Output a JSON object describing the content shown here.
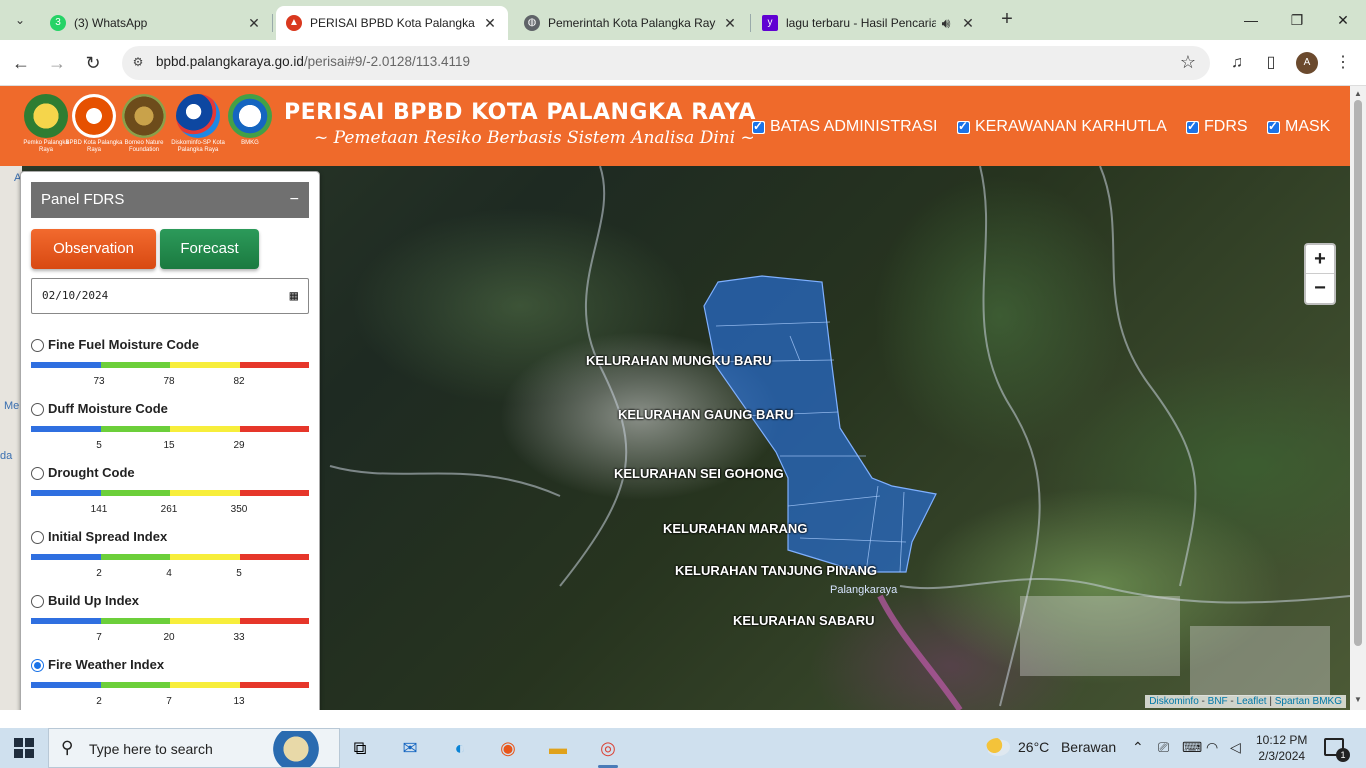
{
  "browser": {
    "tabs": [
      {
        "title": "(3) WhatsApp",
        "icon": "whatsapp-icon",
        "badge": "3",
        "color": "#25d366"
      },
      {
        "title": "PERISAI BPBD Kota Palangka Raya",
        "icon": "bpbd-icon",
        "color": "#d9381e"
      },
      {
        "title": "Pemerintah Kota Palangka Raya",
        "icon": "globe-icon",
        "color": "#5f6368"
      },
      {
        "title": "lagu terbaru - Hasil Pencarian",
        "icon": "yahoo-icon",
        "color": "#6001d2"
      }
    ],
    "url_host": "bpbd.palangkaraya.go.id",
    "url_path": "/perisai#9/-2.0128/113.4119",
    "avatar_initial": "A"
  },
  "header": {
    "title": "PERISAI BPBD KOTA PALANGKA RAYA",
    "subtitle": "~ Pemetaan Resiko Berbasis Sistem Analisa Dini ~",
    "logos": [
      {
        "caption": "Pemko Palangka Raya",
        "color": "#2e7d32"
      },
      {
        "caption": "BPBD Kota Palangka Raya",
        "color": "#e65100"
      },
      {
        "caption": "Borneo Nature Foundation",
        "color": "#6d4c1b"
      },
      {
        "caption": "Diskominfo-SP Kota Palangka Raya",
        "color": "#0d47a1"
      },
      {
        "caption": "BMKG",
        "color": "#1565c0"
      }
    ],
    "layers": [
      {
        "label": "BATAS ADMINISTRASI",
        "checked": true
      },
      {
        "label": "KERAWANAN KARHUTLA",
        "checked": true
      },
      {
        "label": "FDRS",
        "checked": true
      },
      {
        "label": "MASK",
        "checked": true
      }
    ]
  },
  "map": {
    "labels": [
      "KELURAHAN MUNGKU BARU",
      "KELURAHAN GAUNG BARU",
      "KELURAHAN SEI GOHONG",
      "KELURAHAN MARANG",
      "KELURAHAN TANJUNG PINANG",
      "KELURAHAN SABARU"
    ],
    "city_label": "Palangkaraya",
    "zoom_in": "+",
    "zoom_out": "−",
    "attribution": {
      "a": "Diskominfo",
      "b": "BNF",
      "c": "Leaflet",
      "d": "Spartan BMKG",
      "sep": " - ",
      "sep2": " | "
    },
    "edge_texts": [
      "A",
      "Me",
      "da"
    ]
  },
  "panel": {
    "title": "Panel FDRS",
    "collapse": "−",
    "observation": "Observation",
    "forecast": "Forecast",
    "date": "02/10/2024",
    "bar_colors": [
      "#2f6fe0",
      "#6ccf3a",
      "#f7ee3b",
      "#e6362a"
    ],
    "indices": [
      {
        "name": "Fine Fuel Moisture Code",
        "ticks": [
          "73",
          "78",
          "82"
        ],
        "selected": false
      },
      {
        "name": "Duff Moisture Code",
        "ticks": [
          "5",
          "15",
          "29"
        ],
        "selected": false
      },
      {
        "name": "Drought Code",
        "ticks": [
          "141",
          "261",
          "350"
        ],
        "selected": false
      },
      {
        "name": "Initial Spread Index",
        "ticks": [
          "2",
          "4",
          "5"
        ],
        "selected": false
      },
      {
        "name": "Build Up Index",
        "ticks": [
          "7",
          "20",
          "33"
        ],
        "selected": false
      },
      {
        "name": "Fire Weather Index",
        "ticks": [
          "2",
          "7",
          "13"
        ],
        "selected": true
      }
    ]
  },
  "taskbar": {
    "search_placeholder": "Type here to search",
    "weather_temp": "26°C",
    "weather_desc": "Berawan",
    "time": "10:12 PM",
    "date": "2/3/2024",
    "notifications": "1"
  }
}
